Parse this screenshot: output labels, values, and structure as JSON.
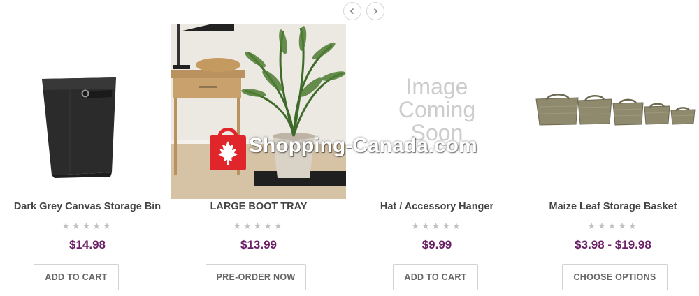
{
  "carousel": {
    "prev_icon": "chevron-left-icon",
    "next_icon": "chevron-right-icon"
  },
  "products": [
    {
      "title": "Dark Grey Canvas Storage Bin",
      "stars": "★★★★★",
      "price": "$14.98",
      "button": "ADD TO CART"
    },
    {
      "title": "LARGE BOOT TRAY",
      "stars": "★★★★★",
      "price": "$13.99",
      "button": "PRE-ORDER NOW"
    },
    {
      "title": "Hat / Accessory Hanger",
      "stars": "★★★★★",
      "price": "$9.99",
      "button": "ADD TO CART",
      "placeholder_lines": [
        "Image",
        "Coming",
        "Soon"
      ]
    },
    {
      "title": "Maize Leaf Storage Basket",
      "stars": "★★★★★",
      "price": "$3.98 - $19.98",
      "button": "CHOOSE OPTIONS"
    }
  ],
  "watermark": {
    "text": "Shopping-Canada.com"
  },
  "colors": {
    "price": "#6a1f66",
    "stars": "#c2c2c2",
    "watermark_red": "#e0262b"
  }
}
